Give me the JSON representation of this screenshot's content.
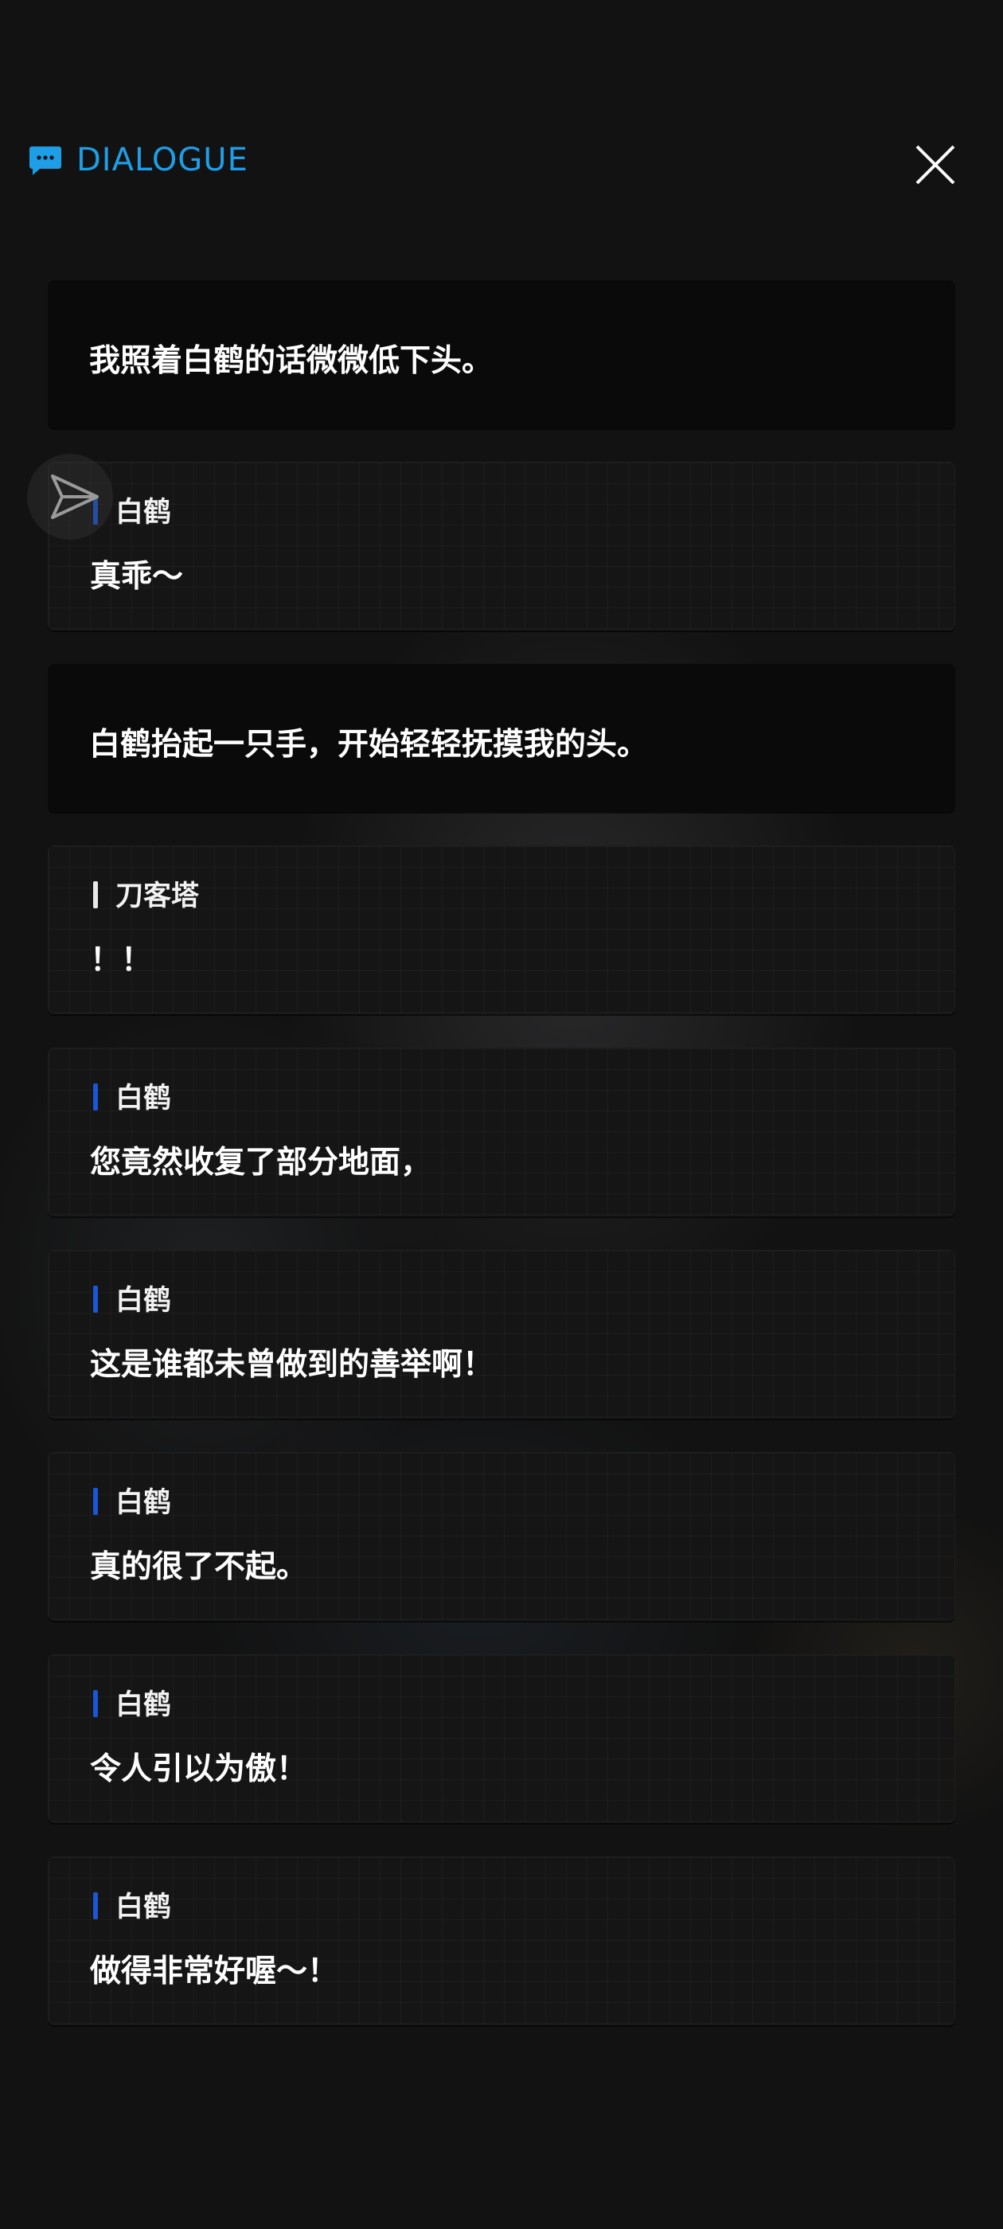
{
  "header": {
    "title": "DIALOGUE",
    "icon": "chat-bubble-icon",
    "close_icon": "close-icon",
    "accent_color": "#1e9ee6"
  },
  "floating": {
    "icon": "send-arrow-icon"
  },
  "dialogue": [
    {
      "type": "narration",
      "text": "我照着白鹤的话微微低下头。"
    },
    {
      "type": "speech",
      "speaker": "白鹤",
      "bar_color": "#1a56d6",
      "text": "真乖～"
    },
    {
      "type": "narration",
      "text": "白鹤抬起一只手，开始轻轻抚摸我的头。"
    },
    {
      "type": "speech",
      "speaker": "刀客塔",
      "bar_color": "#e8e8e8",
      "text": "！！"
    },
    {
      "type": "speech",
      "speaker": "白鹤",
      "bar_color": "#1a56d6",
      "text": "您竟然收复了部分地面，"
    },
    {
      "type": "speech",
      "speaker": "白鹤",
      "bar_color": "#1a56d6",
      "text": "这是谁都未曾做到的善举啊！"
    },
    {
      "type": "speech",
      "speaker": "白鹤",
      "bar_color": "#1a56d6",
      "text": "真的很了不起。"
    },
    {
      "type": "speech",
      "speaker": "白鹤",
      "bar_color": "#1a56d6",
      "text": "令人引以为傲！"
    },
    {
      "type": "speech",
      "speaker": "白鹤",
      "bar_color": "#1a56d6",
      "text": "做得非常好喔～！"
    }
  ]
}
